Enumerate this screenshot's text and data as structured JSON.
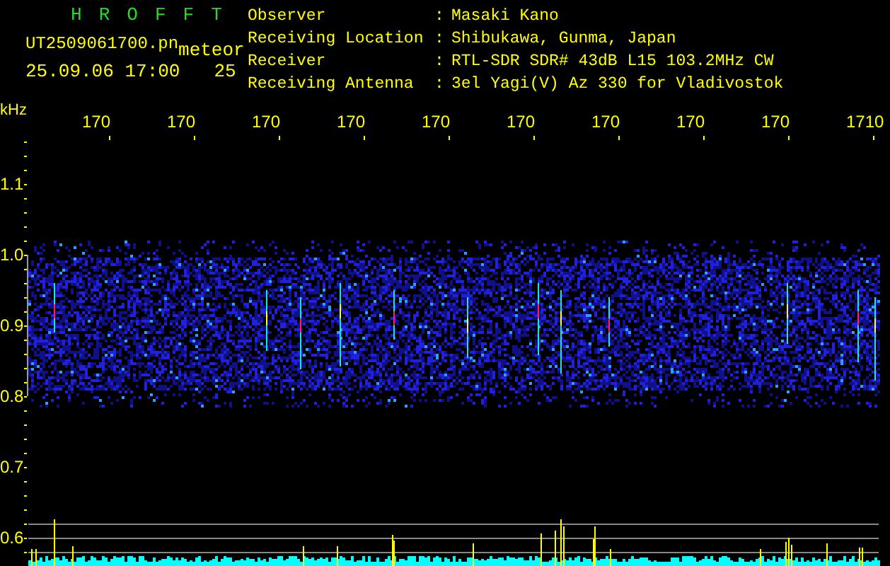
{
  "title_letters": [
    "H",
    "R",
    "O",
    "F",
    "F",
    "T"
  ],
  "file_name": "UT2509061700.pn",
  "tag": "meteor",
  "timestamp": "25.09.06 17:00",
  "short_value": "25",
  "info": [
    {
      "label": "Observer",
      "separator": ":",
      "value": "Masaki Kano"
    },
    {
      "label": "Receiving Location",
      "separator": ":",
      "value": "Shibukawa, Gunma, Japan"
    },
    {
      "label": "Receiver",
      "separator": ":",
      "value": "RTL-SDR SDR# 43dB L15 103.2MHz CW"
    },
    {
      "label": "Receiving Antenna",
      "separator": ":",
      "value": "3el Yagi(V) Az 330 for Vladivostok"
    }
  ],
  "plot": {
    "unit": "kHz",
    "x_labels": [
      "170",
      "170",
      "170",
      "170",
      "170",
      "170",
      "170",
      "170",
      "170",
      "1710"
    ],
    "y_labels": [
      "1.1",
      "1.0",
      "0.9",
      "0.8",
      "0.7",
      "0.6"
    ]
  }
}
